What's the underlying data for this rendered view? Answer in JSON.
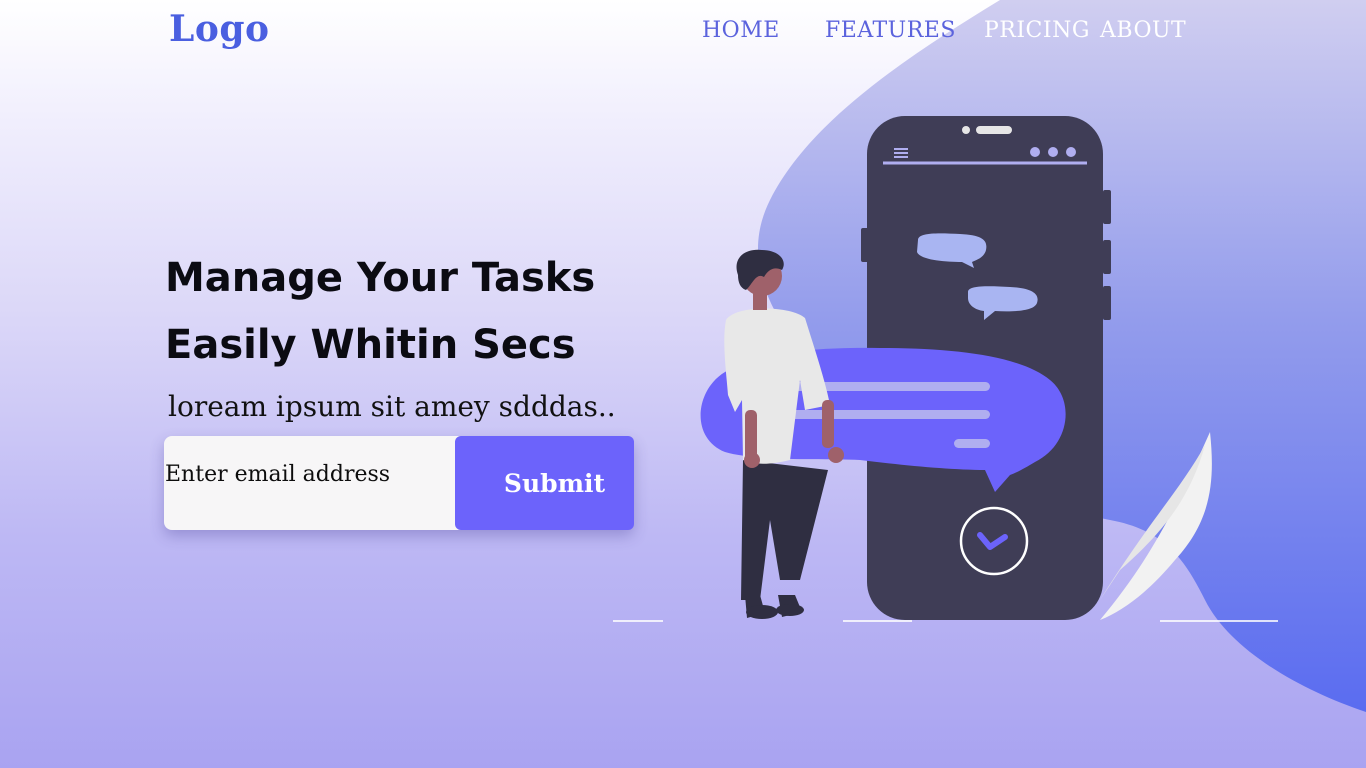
{
  "brand": {
    "logo_text": "Logo"
  },
  "nav": {
    "items": [
      "HOME",
      "FEATURES",
      "PRICING",
      "ABOUT"
    ]
  },
  "hero": {
    "headline_line1": "Manage Your Tasks",
    "headline_line2": "Easily Whitin Secs",
    "subtitle": "loream ipsum sit amey sdddas.."
  },
  "signup": {
    "email_placeholder": "Enter email address",
    "email_value": "",
    "submit_label": "Submit"
  },
  "colors": {
    "accent": "#6c63fb",
    "nav_link": "#5b63dd",
    "logo": "#4a5fe0",
    "phone": "#3f3d56"
  },
  "icons": [
    "person-illustration",
    "phone-illustration",
    "chat-bubble-icon",
    "check-circle-icon",
    "menu-icon"
  ]
}
